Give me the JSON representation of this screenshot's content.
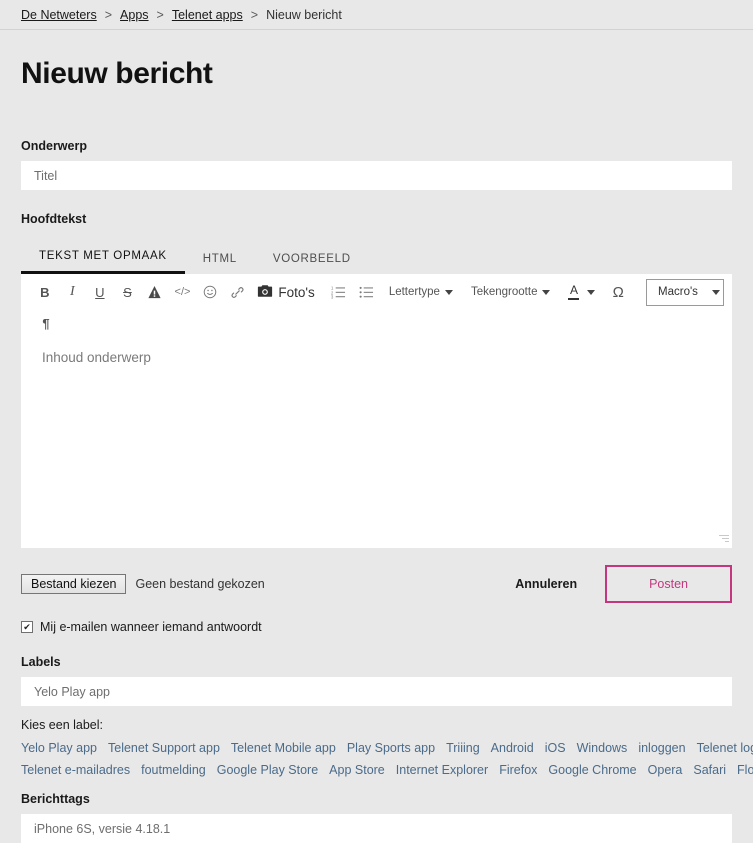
{
  "breadcrumb": {
    "separator": ">",
    "items": [
      {
        "label": "De Netweters",
        "link": true
      },
      {
        "label": "Apps",
        "link": true
      },
      {
        "label": "Telenet apps",
        "link": true
      },
      {
        "label": "Nieuw bericht",
        "link": false
      }
    ]
  },
  "page": {
    "title": "Nieuw bericht"
  },
  "subject": {
    "label": "Onderwerp",
    "placeholder": "Titel",
    "value": ""
  },
  "body": {
    "label": "Hoofdtekst",
    "tabs": [
      {
        "label": "TEKST MET OPMAAK",
        "active": true
      },
      {
        "label": "HTML",
        "active": false
      },
      {
        "label": "VOORBEELD",
        "active": false
      }
    ],
    "placeholder": "Inhoud onderwerp",
    "value": ""
  },
  "toolbar": {
    "bold": "B",
    "italic": "I",
    "underline": "U",
    "strikethrough": "S",
    "text_highlight": "A",
    "code": "</>",
    "emoji": "☺",
    "link": "🔗",
    "photos_label": "Foto's",
    "ordered_list": "ordered-list-icon",
    "unordered_list": "unordered-list-icon",
    "font_family_label": "Lettertype",
    "font_size_label": "Tekengrootte",
    "font_color_label": "A",
    "special_char": "Ω",
    "macros_label": "Macro's",
    "paragraph": "¶"
  },
  "attachment": {
    "button_label": "Bestand kiezen",
    "status": "Geen bestand gekozen"
  },
  "actions": {
    "cancel_label": "Annuleren",
    "post_label": "Posten",
    "post_color": "#c4377f"
  },
  "notify": {
    "label": "Mij e-mailen wanneer iemand antwoordt",
    "checked": true,
    "checkmark": "✔"
  },
  "labels": {
    "label": "Labels",
    "value": "Yelo Play app",
    "choose_text": "Kies een label:",
    "link_color": "#4a6b8a",
    "rows": [
      [
        "Yelo Play app",
        "Telenet Support app",
        "Telenet Mobile app",
        "Play Sports app",
        "Triiing",
        "Android",
        "iOS",
        "Windows",
        "inloggen",
        "Telenet login"
      ],
      [
        "Telenet e-mailadres",
        "foutmelding",
        "Google Play Store",
        "App Store",
        "Internet Explorer",
        "Firefox",
        "Google Chrome",
        "Opera",
        "Safari",
        "Flow"
      ]
    ]
  },
  "message_tags": {
    "label": "Berichttags",
    "value": "iPhone 6S, versie 4.18.1"
  }
}
